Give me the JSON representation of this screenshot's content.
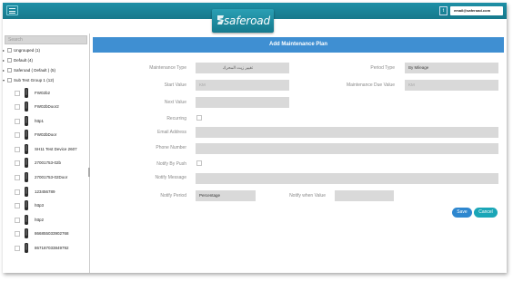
{
  "header": {
    "logo_text": "saferoad",
    "user_email": "email@saferoad.com",
    "flag_glyph": "t"
  },
  "sidebar": {
    "search_placeholder": "Search",
    "groups": [
      {
        "label": "Ungrouped (1)",
        "expanded": false
      },
      {
        "label": "Default (4)",
        "expanded": false
      },
      {
        "label": "Saferoad ( Default ) (5)",
        "expanded": false
      },
      {
        "label": "Sub Test Group 1 (12)",
        "expanded": true
      }
    ],
    "devices": [
      "FW02b2",
      "FW02bDoor2",
      "http1",
      "FW02bDoor",
      "SH11 Test Device 2607",
      "27001753-02b",
      "27001753-02Door",
      "123456789",
      "http3",
      "http2",
      "866855033902768",
      "867187033849792"
    ]
  },
  "form": {
    "title": "Add Maintenance Plan",
    "maintenance_type_label": "Maintenance Type",
    "maintenance_type_value": "تغيير زيت المحرك",
    "period_type_label": "Period Type",
    "period_type_value": "By Mileage",
    "start_value_label": "Start Value",
    "start_value_placeholder": "KM",
    "due_value_label": "Maintenance Due Value",
    "due_value_placeholder": "KM",
    "next_value_label": "Next Value",
    "recurring_label": "Recurring",
    "recurring_checked": false,
    "email_label": "Email Address",
    "phone_label": "Phone Number",
    "notify_push_label": "Notify By Push",
    "notify_push_checked": false,
    "notify_message_label": "Notify Message",
    "notify_period_label": "Notify Period",
    "notify_period_value": "Percentage",
    "notify_when_label": "Notify when Value",
    "save_label": "Save",
    "cancel_label": "Cancel"
  },
  "colors": {
    "topbar": "#1e8fa6",
    "panel_header": "#3f8fd2",
    "save": "#2e87cf",
    "cancel": "#1aa6b7"
  }
}
